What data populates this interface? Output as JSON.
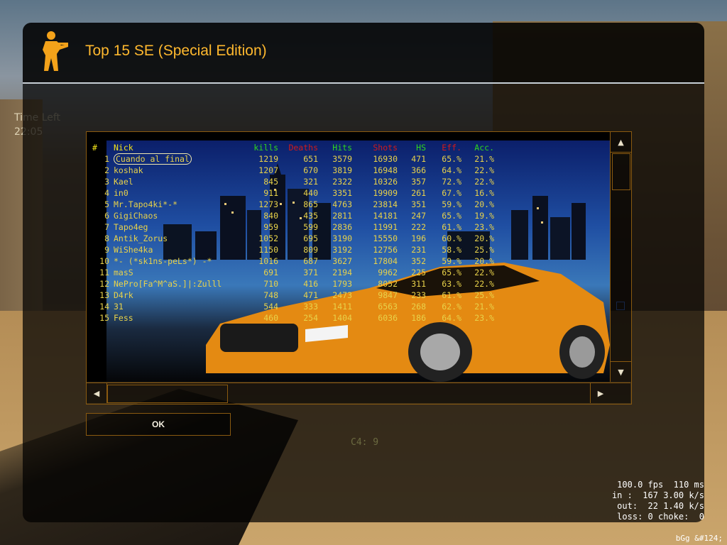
{
  "hud": {
    "time_left_label": "Time Left",
    "time_left_value": "22:05",
    "c4_text": "C4: 9",
    "netgraph": {
      "fps": "100.0 fps  110 ms",
      "in": "in :  167 3.00 k/s",
      "out": "out:  22 1.40 k/s",
      "loss": "loss: 0 choke:  0"
    },
    "corner": "bGg &#124;"
  },
  "dialog": {
    "title": "Top 15 SE (Special Edition)",
    "ok_label": "OK",
    "scroll_up": "▲",
    "scroll_down": "▼",
    "scroll_left": "◀",
    "scroll_right": "▶"
  },
  "stats": {
    "headers": {
      "rank": "#",
      "nick": "Nick",
      "kills": "kills",
      "deaths": "Deaths",
      "hits": "Hits",
      "shots": "Shots",
      "hs": "HS",
      "eff": "Eff.",
      "acc": "Acc."
    },
    "rows": [
      {
        "rank": "1",
        "nick": "Cuando al final",
        "kills": "1219",
        "deaths": "651",
        "hits": "3579",
        "shots": "16930",
        "hs": "471",
        "eff": "65.%",
        "acc": "21.%"
      },
      {
        "rank": "2",
        "nick": "koshak",
        "kills": "1207",
        "deaths": "670",
        "hits": "3819",
        "shots": "16948",
        "hs": "366",
        "eff": "64.%",
        "acc": "22.%"
      },
      {
        "rank": "3",
        "nick": "Kael",
        "kills": "845",
        "deaths": "321",
        "hits": "2322",
        "shots": "10326",
        "hs": "357",
        "eff": "72.%",
        "acc": "22.%"
      },
      {
        "rank": "4",
        "nick": "in0",
        "kills": "911",
        "deaths": "440",
        "hits": "3351",
        "shots": "19909",
        "hs": "261",
        "eff": "67.%",
        "acc": "16.%"
      },
      {
        "rank": "5",
        "nick": "Mr.Tapo4ki*-*",
        "kills": "1273",
        "deaths": "865",
        "hits": "4763",
        "shots": "23814",
        "hs": "351",
        "eff": "59.%",
        "acc": "20.%"
      },
      {
        "rank": "6",
        "nick": "GigiChaos",
        "kills": "840",
        "deaths": "435",
        "hits": "2811",
        "shots": "14181",
        "hs": "247",
        "eff": "65.%",
        "acc": "19.%"
      },
      {
        "rank": "7",
        "nick": "Tapo4eg",
        "kills": "959",
        "deaths": "599",
        "hits": "2836",
        "shots": "11991",
        "hs": "222",
        "eff": "61.%",
        "acc": "23.%"
      },
      {
        "rank": "8",
        "nick": "Antik_Zorus",
        "kills": "1052",
        "deaths": "695",
        "hits": "3190",
        "shots": "15550",
        "hs": "196",
        "eff": "60.%",
        "acc": "20.%"
      },
      {
        "rank": "9",
        "nick": "WiShe4ka",
        "kills": "1150",
        "deaths": "809",
        "hits": "3192",
        "shots": "12756",
        "hs": "231",
        "eff": "58.%",
        "acc": "25.%"
      },
      {
        "rank": "10",
        "nick": "*- (*sk1ns-peLs*) -*",
        "kills": "1016",
        "deaths": "687",
        "hits": "3627",
        "shots": "17804",
        "hs": "352",
        "eff": "59.%",
        "acc": "20.%"
      },
      {
        "rank": "11",
        "nick": "masS",
        "kills": "691",
        "deaths": "371",
        "hits": "2194",
        "shots": "9962",
        "hs": "225",
        "eff": "65.%",
        "acc": "22.%"
      },
      {
        "rank": "12",
        "nick": "NePro[Fa^M^aS.]|:Zulll",
        "kills": "710",
        "deaths": "416",
        "hits": "1793",
        "shots": "8052",
        "hs": "311",
        "eff": "63.%",
        "acc": "22.%"
      },
      {
        "rank": "13",
        "nick": "D4rk",
        "kills": "748",
        "deaths": "471",
        "hits": "2473",
        "shots": "9847",
        "hs": "233",
        "eff": "61.%",
        "acc": "25.%"
      },
      {
        "rank": "14",
        "nick": "31",
        "kills": "544",
        "deaths": "333",
        "hits": "1411",
        "shots": "6563",
        "hs": "268",
        "eff": "62.%",
        "acc": "21.%"
      },
      {
        "rank": "15",
        "nick": "Fess",
        "kills": "460",
        "deaths": "254",
        "hits": "1404",
        "shots": "6036",
        "hs": "186",
        "eff": "64.%",
        "acc": "23.%"
      }
    ]
  },
  "colors": {
    "title": "#ffb82e",
    "stat_text": "#e8d24a",
    "header_green": "#2fd61e",
    "header_red": "#d21a1a",
    "header_yellow": "#f2e21a"
  },
  "icons": {
    "logo": "counter-terrorist-icon"
  }
}
